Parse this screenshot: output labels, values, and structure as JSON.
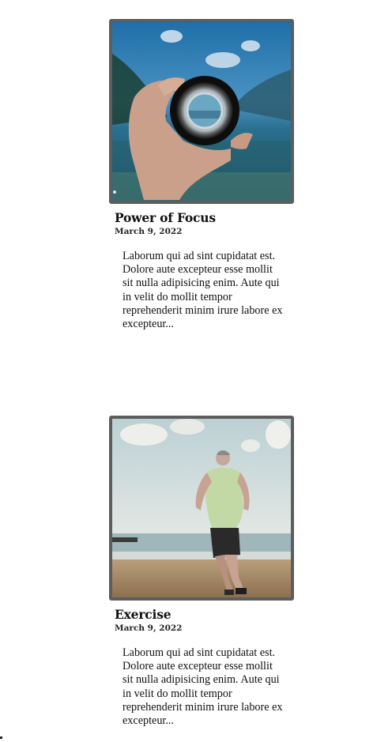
{
  "posts": [
    {
      "title": "Power of Focus",
      "date": "March 9, 2022",
      "excerpt": "Laborum qui ad sint cupidatat est. Dolore aute excepteur esse mollit sit nulla adipisicing enim. Aute qui in velit do mollit tempor reprehenderit minim irure labore ex excepteur...",
      "image_icon": "camera-lens-photo"
    },
    {
      "title": "Exercise",
      "date": "March 9, 2022",
      "excerpt": "Laborum qui ad sint cupidatat est. Dolore aute excepteur esse mollit sit nulla adipisicing enim. Aute qui in velit do mollit tempor reprehenderit minim irure labore ex excepteur...",
      "image_icon": "runner-on-beach-photo"
    }
  ],
  "colors": {
    "frame_border": "#5d5d5d",
    "text": "#111111"
  }
}
